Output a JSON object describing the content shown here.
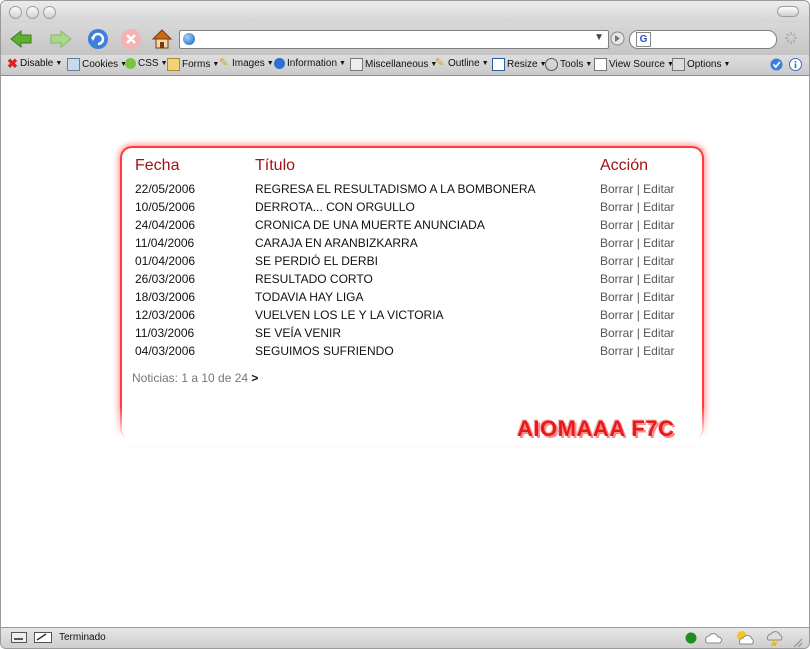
{
  "devbar": {
    "items": [
      "Disable",
      "Cookies",
      "CSS",
      "Forms",
      "Images",
      "Information",
      "Miscellaneous",
      "Outline",
      "Resize",
      "Tools",
      "View Source",
      "Options"
    ]
  },
  "table": {
    "headers": {
      "date": "Fecha",
      "title": "Título",
      "action": "Acción"
    },
    "rows": [
      {
        "date": "22/05/2006",
        "title": "REGRESA EL RESULTADISMO A LA BOMBONERA"
      },
      {
        "date": "10/05/2006",
        "title": "DERROTA... CON ORGULLO"
      },
      {
        "date": "24/04/2006",
        "title": "CRONICA DE UNA MUERTE ANUNCIADA"
      },
      {
        "date": "11/04/2006",
        "title": "CARAJA EN ARANBIZKARRA"
      },
      {
        "date": "01/04/2006",
        "title": "SE PERDIÓ EL DERBI"
      },
      {
        "date": "26/03/2006",
        "title": "RESULTADO CORTO"
      },
      {
        "date": "18/03/2006",
        "title": "TODAVIA HAY LIGA"
      },
      {
        "date": "12/03/2006",
        "title": "VUELVEN LOS LE Y LA VICTORIA"
      },
      {
        "date": "11/03/2006",
        "title": "SE VEÍA VENIR"
      },
      {
        "date": "04/03/2006",
        "title": "SEGUIMOS SUFRIENDO"
      }
    ],
    "delete_label": "Borrar",
    "separator": "|",
    "edit_label": "Editar"
  },
  "pagination": {
    "text": "Noticias: 1 a 10 de 24",
    "next": ">"
  },
  "logo_text": "AIOMAAA F7C",
  "status": {
    "text": "Terminado"
  },
  "colors": {
    "accent": "#a31414",
    "panel_border": "#ff3b3b",
    "logo": "#e41b1b"
  }
}
